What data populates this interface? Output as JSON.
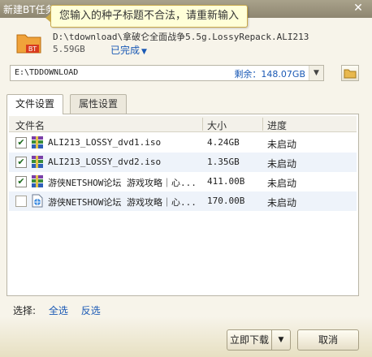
{
  "window": {
    "title": "新建BT任务",
    "close": "✕"
  },
  "tooltip": {
    "text": "您输入的种子标题不合法，请重新输入"
  },
  "torrent": {
    "path": "D:\\tdownload\\拿破仑全面战争5.5g.LossyRepack.ALI213",
    "size": "5.59GB",
    "status": "已完成",
    "icon_badge": "BT"
  },
  "save_path": {
    "value": "E:\\TDDOWNLOAD",
    "free_space": "剩余：148.07GB"
  },
  "tabs": [
    {
      "label": "文件设置"
    },
    {
      "label": "属性设置"
    }
  ],
  "file_list": {
    "columns": [
      "文件名",
      "大小",
      "进度"
    ],
    "rows": [
      {
        "checked": true,
        "icon": "rar-archive-icon",
        "name": "ALI213_LOSSY_dvd1.iso",
        "size": "4.24GB",
        "progress": "未启动"
      },
      {
        "checked": true,
        "icon": "rar-archive-icon",
        "name": "ALI213_LOSSY_dvd2.iso",
        "size": "1.35GB",
        "progress": "未启动"
      },
      {
        "checked": true,
        "icon": "rar-archive-icon",
        "name": "游侠NETSHOW论坛 游戏攻略｜心...",
        "size": "411.00B",
        "progress": "未启动"
      },
      {
        "checked": false,
        "icon": "web-shortcut-icon",
        "name": "游侠NETSHOW论坛 游戏攻略｜心...",
        "size": "170.00B",
        "progress": "未启动"
      }
    ]
  },
  "selection": {
    "label": "选择:",
    "all": "全选",
    "invert": "反选"
  },
  "buttons": {
    "download": "立即下载",
    "cancel": "取消"
  },
  "colors": {
    "link": "#1a59b5",
    "tooltip_bg": "#ffffd8",
    "row_alt": "#eef3fa"
  }
}
